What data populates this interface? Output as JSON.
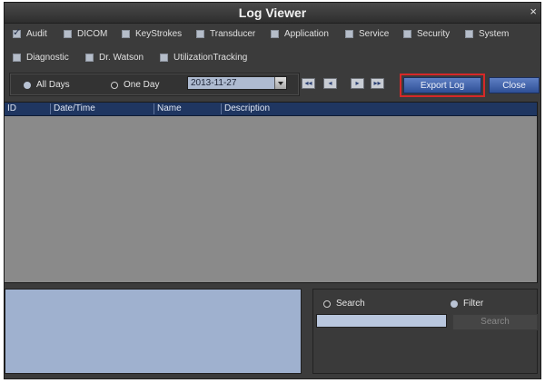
{
  "window": {
    "title": "Log Viewer",
    "close_glyph": "×"
  },
  "categories": [
    {
      "label": "Audit",
      "checked": true
    },
    {
      "label": "DICOM",
      "checked": false
    },
    {
      "label": "KeyStrokes",
      "checked": false
    },
    {
      "label": "Transducer",
      "checked": false
    },
    {
      "label": "Application",
      "checked": false
    },
    {
      "label": "Service",
      "checked": false
    },
    {
      "label": "Security",
      "checked": false
    },
    {
      "label": "System",
      "checked": false
    },
    {
      "label": "Diagnostic",
      "checked": false
    },
    {
      "label": "Dr. Watson",
      "checked": false
    },
    {
      "label": "UtilizationTracking",
      "checked": false
    }
  ],
  "range": {
    "all_days_label": "All Days",
    "one_day_label": "One Day",
    "selected": "All Days",
    "date_value": "2013-11-27"
  },
  "nav_buttons": [
    {
      "icon": "first-page-icon",
      "glyph": "◂◂"
    },
    {
      "icon": "previous-page-icon",
      "glyph": "◂"
    },
    {
      "icon": "next-page-icon",
      "glyph": "▸"
    },
    {
      "icon": "last-page-icon",
      "glyph": "▸▸"
    }
  ],
  "actions": {
    "export_label": "Export Log",
    "close_label": "Close"
  },
  "table": {
    "columns": [
      "ID",
      "Date/Time",
      "Name",
      "Description"
    ],
    "rows": []
  },
  "search": {
    "search_label": "Search",
    "filter_label": "Filter",
    "mode": "Filter",
    "input_value": "",
    "button_label": "Search"
  }
}
